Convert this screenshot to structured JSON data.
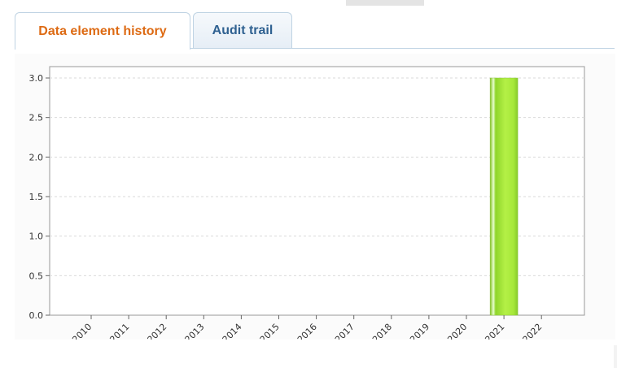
{
  "tabs": [
    {
      "label": "Data element history",
      "active": true
    },
    {
      "label": "Audit trail",
      "active": false
    }
  ],
  "colors": {
    "active_tab_text": "#dd6a13",
    "inactive_tab_text": "#2f6191",
    "bar_fill": "#a6e83a"
  },
  "chart_data": {
    "type": "bar",
    "categories": [
      "2010",
      "2011",
      "2012",
      "2013",
      "2014",
      "2015",
      "2016",
      "2017",
      "2018",
      "2019",
      "2020",
      "2021",
      "2022"
    ],
    "values": [
      0,
      0,
      0,
      0,
      0,
      0,
      0,
      0,
      0,
      0,
      0,
      3.0,
      0
    ],
    "y_ticks": [
      "0.0",
      "0.5",
      "1.0",
      "1.5",
      "2.0",
      "2.5",
      "3.0"
    ],
    "ylim": [
      0,
      3.0
    ],
    "grid": true,
    "title": "",
    "xlabel": "",
    "ylabel": ""
  }
}
